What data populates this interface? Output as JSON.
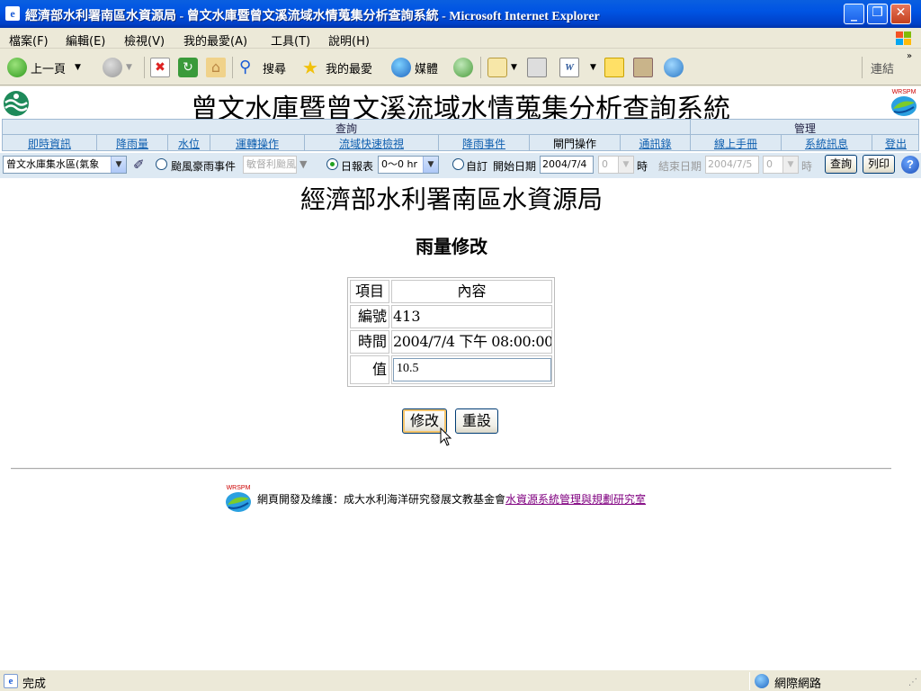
{
  "window": {
    "title": "經濟部水利署南區水資源局 - 曾文水庫暨曾文溪流域水情蒐集分析查詢系統 - Microsoft Internet Explorer"
  },
  "menu": [
    "檔案(F)",
    "編輯(E)",
    "檢視(V)",
    "我的最愛(A)",
    "工具(T)",
    "說明(H)"
  ],
  "toolbar": {
    "back": "上一頁",
    "search": "搜尋",
    "favorites": "我的最愛",
    "media": "媒體",
    "links": "連結"
  },
  "system": {
    "title": "曾文水庫暨曾文溪流域水情蒐集分析查詢系統",
    "logo_text": "WRSPM"
  },
  "nav": {
    "groups": [
      "查詢",
      "管理"
    ],
    "links": [
      "即時資訊",
      "降雨量",
      "水位",
      "運轉操作",
      "流域快速檢視",
      "降雨事件",
      "閘門操作",
      "通訊錄",
      "線上手冊",
      "系統訊息",
      "登出"
    ]
  },
  "query": {
    "area_select": "曾文水庫集水區(氣象",
    "typhoon_label": "颱風豪雨事件",
    "typhoon_select": "敏督利颱風",
    "daily_label": "日報表",
    "hour_range": "0～0 hr",
    "custom_label": "自訂",
    "start_label": "開始日期",
    "start_date": "2004/7/4",
    "start_hour": "0",
    "hour_unit": "時",
    "end_label": "結束日期",
    "end_date": "2004/7/5",
    "end_hour": "0",
    "query_button": "查詢",
    "print_button": "列印",
    "selected_mode": "日報表"
  },
  "page": {
    "org_title": "經濟部水利署南區水資源局",
    "form_title": "雨量修改"
  },
  "table": {
    "headers": [
      "項目",
      "內容"
    ],
    "rows": [
      {
        "label": "編號",
        "value": "413"
      },
      {
        "label": "時間",
        "value": "2004/7/4 下午 08:00:00"
      },
      {
        "label": "值",
        "value": "10.5"
      }
    ]
  },
  "buttons": {
    "modify": "修改",
    "reset": "重設"
  },
  "footer": {
    "text": "網頁開發及維護：成大水利海洋研究發展文教基金會",
    "link": "水資源系統管理與規劃研究室"
  },
  "status": {
    "left": "完成",
    "zone": "網際網路"
  }
}
